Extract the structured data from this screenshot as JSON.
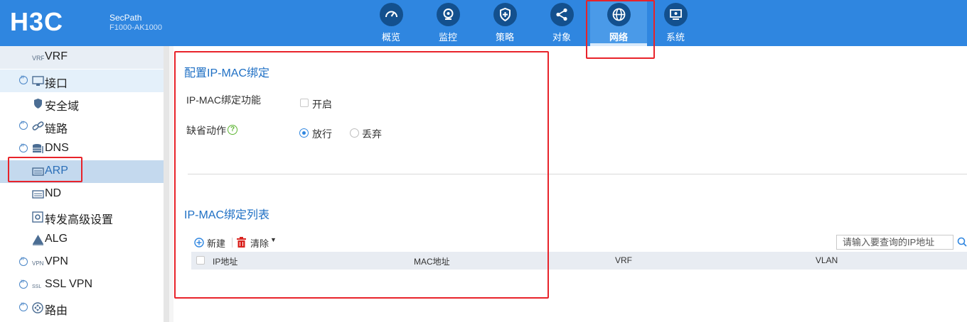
{
  "header": {
    "brand": "SecPath",
    "model": "F1000-AK1000",
    "nav": [
      {
        "label": "概览",
        "icon": "dashboard-icon"
      },
      {
        "label": "监控",
        "icon": "monitor-icon"
      },
      {
        "label": "策略",
        "icon": "shield-plus-icon"
      },
      {
        "label": "对象",
        "icon": "share-nodes-icon"
      },
      {
        "label": "网络",
        "icon": "globe-icon",
        "active": true
      },
      {
        "label": "系统",
        "icon": "system-icon"
      }
    ],
    "accent": "#2f86e0"
  },
  "sidebar": {
    "items": [
      {
        "label": "VRF"
      },
      {
        "label": "接口"
      },
      {
        "label": "安全域"
      },
      {
        "label": "链路"
      },
      {
        "label": "DNS"
      },
      {
        "label": "ARP",
        "selected": true
      },
      {
        "label": "ND"
      },
      {
        "label": "转发高级设置"
      },
      {
        "label": "ALG"
      },
      {
        "label": "VPN"
      },
      {
        "label": "SSL VPN"
      },
      {
        "label": "路由"
      }
    ]
  },
  "config": {
    "title": "配置IP-MAC绑定",
    "enable_label": "IP-MAC绑定功能",
    "enable_option": "开启",
    "default_action_label": "缺省动作",
    "help": "?",
    "action_permit": "放行",
    "action_drop": "丢弃"
  },
  "list": {
    "title": "IP-MAC绑定列表",
    "new_button": "新建",
    "clear_button": "清除",
    "search_placeholder": "请输入要查询的IP地址",
    "columns": [
      "IP地址",
      "MAC地址",
      "VRF",
      "VLAN"
    ]
  }
}
